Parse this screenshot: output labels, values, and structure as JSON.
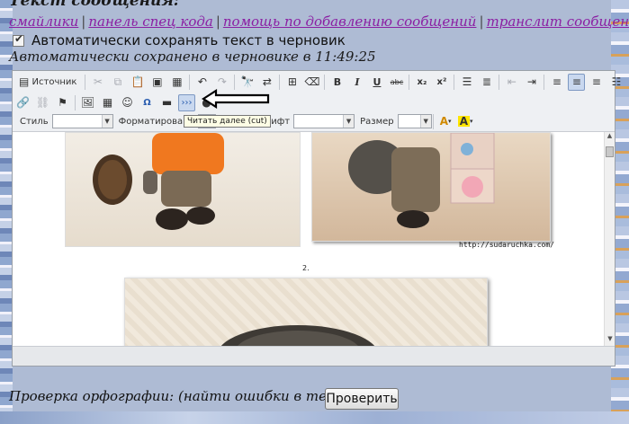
{
  "page": {
    "title": "Текст сообщения:",
    "links": [
      "смайлики",
      "панель спец кода",
      "помощь по добавлению сообщений",
      "транслит сообщения"
    ],
    "autosave_label": "Автоматически сохранять текст в черновик",
    "autosave_status": "Автоматически сохранено в черновике в 11:49:25"
  },
  "toolbar": {
    "source_label": "Источник",
    "style_label": "Стиль",
    "format_label": "Форматировани",
    "font_label": "Шрифт",
    "size_label": "Размер",
    "bold": "B",
    "italic": "I",
    "underline": "U",
    "strike": "abc",
    "subscript": "x₂",
    "superscript": "x²",
    "omega": "Ω",
    "cut_button": "›››",
    "tooltip": "Читать далее (cut)"
  },
  "content": {
    "credit": "http://sudaruchka.com/",
    "item_number": "2."
  },
  "spellcheck": {
    "label": "Проверка орфографии: (найти ошибки в тексте)",
    "button": "Проверить"
  },
  "colors": {
    "link": "#8b1fa3",
    "background": "#aebbd4",
    "toolbar_active": "#c9d8ef"
  },
  "icons": [
    "checkbox-checked-icon",
    "source-icon",
    "cut-icon",
    "copy-icon",
    "paste-icon",
    "paste-text-icon",
    "paste-word-icon",
    "undo-icon",
    "redo-icon",
    "find-icon",
    "replace-icon",
    "select-all-icon",
    "remove-format-icon",
    "numbered-list-icon",
    "bulleted-list-icon",
    "outdent-icon",
    "indent-icon",
    "align-left-icon",
    "align-center-icon",
    "align-right-icon",
    "justify-icon",
    "link-icon",
    "unlink-icon",
    "anchor-icon",
    "image-icon",
    "table-icon",
    "smiley-icon",
    "special-char-icon",
    "horizontal-rule-icon",
    "read-more-icon",
    "text-color-icon",
    "bg-color-icon"
  ]
}
